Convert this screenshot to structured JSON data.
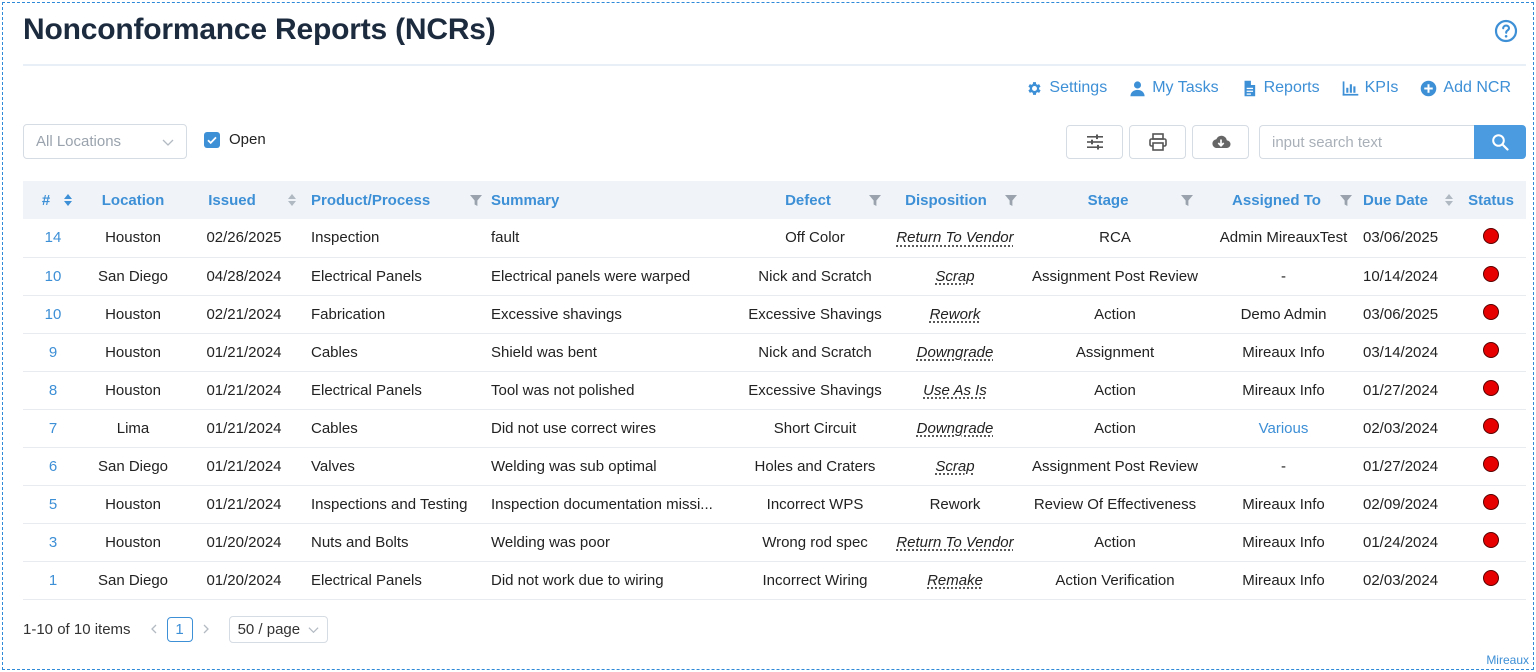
{
  "header": {
    "title": "Nonconformance Reports (NCRs)"
  },
  "nav": [
    {
      "label": "Settings",
      "icon": "gear-icon"
    },
    {
      "label": "My Tasks",
      "icon": "user-icon"
    },
    {
      "label": "Reports",
      "icon": "document-icon"
    },
    {
      "label": "KPIs",
      "icon": "bar-chart-icon"
    },
    {
      "label": "Add NCR",
      "icon": "plus-circle-icon"
    }
  ],
  "filters": {
    "location_select": "All Locations",
    "open_label": "Open",
    "open_checked": true
  },
  "search": {
    "placeholder": "input search text"
  },
  "table": {
    "columns": [
      "#",
      "Location",
      "Issued",
      "Product/Process",
      "Summary",
      "Defect",
      "Disposition",
      "Stage",
      "Assigned To",
      "Due Date",
      "Status"
    ],
    "rows": [
      {
        "num": "14",
        "location": "Houston",
        "issued": "02/26/2025",
        "product": "Inspection",
        "summary": "fault",
        "defect": "Off Color",
        "disposition": "Return To Vendor",
        "disp_link": true,
        "stage": "RCA",
        "assigned": "Admin MireauxTest",
        "assigned_link": false,
        "due": "03/06/2025",
        "status": "red"
      },
      {
        "num": "10",
        "location": "San Diego",
        "issued": "04/28/2024",
        "product": "Electrical Panels",
        "summary": "Electrical panels were warped",
        "defect": "Nick and Scratch",
        "disposition": "Scrap",
        "disp_link": true,
        "stage": "Assignment Post Review",
        "assigned": "-",
        "assigned_link": false,
        "due": "10/14/2024",
        "status": "red"
      },
      {
        "num": "10",
        "location": "Houston",
        "issued": "02/21/2024",
        "product": "Fabrication",
        "summary": "Excessive shavings",
        "defect": "Excessive Shavings",
        "disposition": "Rework",
        "disp_link": true,
        "stage": "Action",
        "assigned": "Demo Admin",
        "assigned_link": false,
        "due": "03/06/2025",
        "status": "red"
      },
      {
        "num": "9",
        "location": "Houston",
        "issued": "01/21/2024",
        "product": "Cables",
        "summary": "Shield was bent",
        "defect": "Nick and Scratch",
        "disposition": "Downgrade",
        "disp_link": true,
        "stage": "Assignment",
        "assigned": "Mireaux Info",
        "assigned_link": false,
        "due": "03/14/2024",
        "status": "red"
      },
      {
        "num": "8",
        "location": "Houston",
        "issued": "01/21/2024",
        "product": "Electrical Panels",
        "summary": "Tool was not polished",
        "defect": "Excessive Shavings",
        "disposition": "Use As Is",
        "disp_link": true,
        "stage": "Action",
        "assigned": "Mireaux Info",
        "assigned_link": false,
        "due": "01/27/2024",
        "status": "red"
      },
      {
        "num": "7",
        "location": "Lima",
        "issued": "01/21/2024",
        "product": "Cables",
        "summary": "Did not use correct wires",
        "defect": "Short Circuit",
        "disposition": "Downgrade",
        "disp_link": true,
        "stage": "Action",
        "assigned": "Various",
        "assigned_link": true,
        "due": "02/03/2024",
        "status": "red"
      },
      {
        "num": "6",
        "location": "San Diego",
        "issued": "01/21/2024",
        "product": "Valves",
        "summary": "Welding was sub optimal",
        "defect": "Holes and Craters",
        "disposition": "Scrap",
        "disp_link": true,
        "stage": "Assignment Post Review",
        "assigned": "-",
        "assigned_link": false,
        "due": "01/27/2024",
        "status": "red"
      },
      {
        "num": "5",
        "location": "Houston",
        "issued": "01/21/2024",
        "product": "Inspections and Testing",
        "summary": "Inspection documentation missi...",
        "defect": "Incorrect WPS",
        "disposition": "Rework",
        "disp_link": false,
        "stage": "Review Of Effectiveness",
        "assigned": "Mireaux Info",
        "assigned_link": false,
        "due": "02/09/2024",
        "status": "red"
      },
      {
        "num": "3",
        "location": "Houston",
        "issued": "01/20/2024",
        "product": "Nuts and Bolts",
        "summary": "Welding was poor",
        "defect": "Wrong rod spec",
        "disposition": "Return To Vendor",
        "disp_link": true,
        "stage": "Action",
        "assigned": "Mireaux Info",
        "assigned_link": false,
        "due": "01/24/2024",
        "status": "red"
      },
      {
        "num": "1",
        "location": "San Diego",
        "issued": "01/20/2024",
        "product": "Electrical Panels",
        "summary": "Did not work due to wiring",
        "defect": "Incorrect Wiring",
        "disposition": "Remake",
        "disp_link": true,
        "stage": "Action Verification",
        "assigned": "Mireaux Info",
        "assigned_link": false,
        "due": "02/03/2024",
        "status": "red"
      }
    ]
  },
  "pagination": {
    "total": "1-10 of 10 items",
    "page": "1",
    "page_size": "50 / page"
  },
  "footer": {
    "brand": "Mireaux"
  },
  "colors": {
    "accent": "#3d8fd6",
    "title": "#1d2b3f",
    "status_red": "#e60000",
    "header_bg": "#f0f4f9"
  }
}
